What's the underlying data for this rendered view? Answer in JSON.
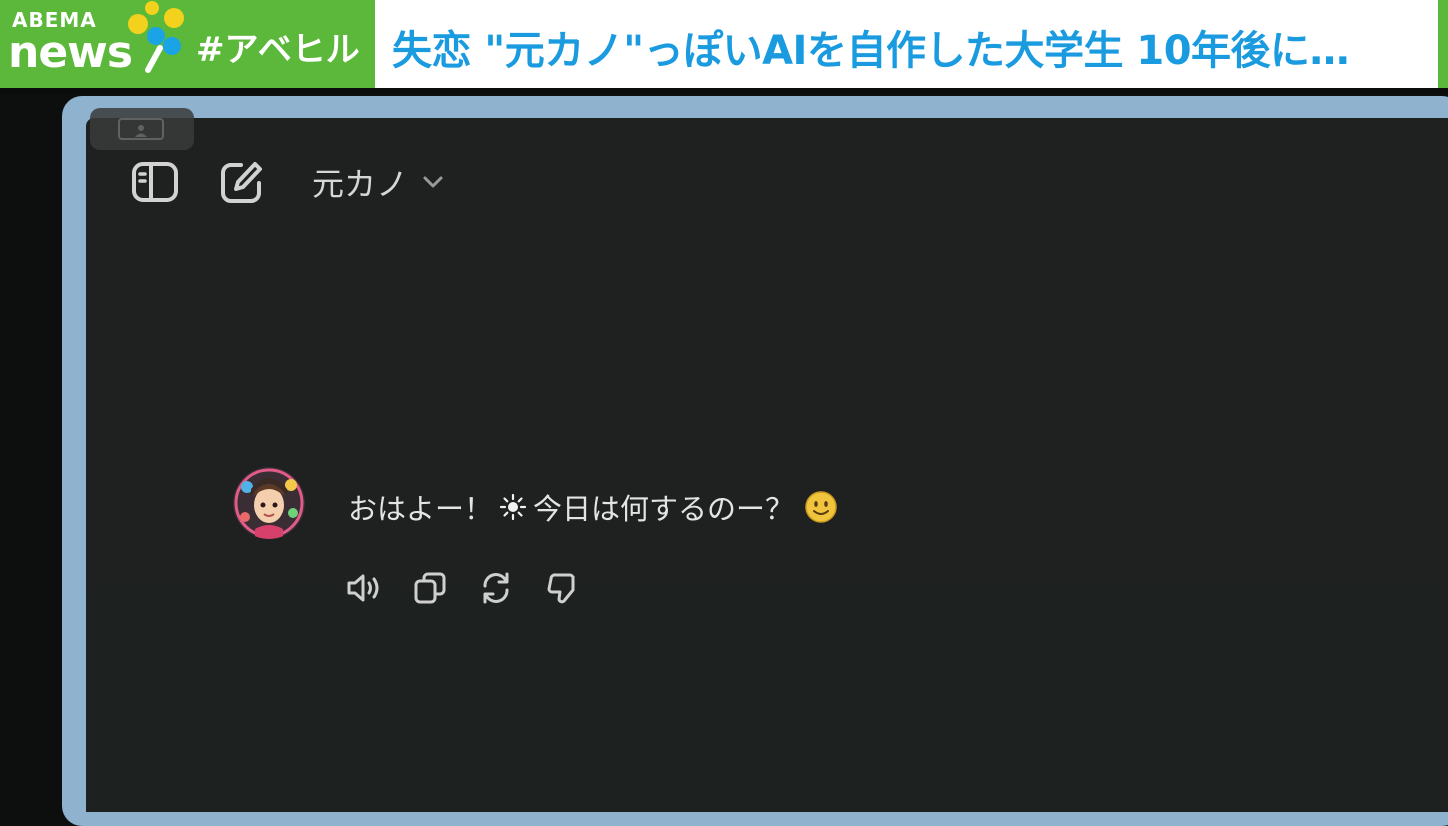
{
  "banner": {
    "logo_top": "ABEMA",
    "logo_bottom": "news",
    "hashtag": "#アベヒル",
    "headline": "失恋 \"元カノ\"っぽいAIを自作した大学生 10年後に…",
    "colors": {
      "green": "#5cb83a",
      "headline_blue": "#1a9be0",
      "yellow": "#f2d21c",
      "blue": "#1aa4e6"
    }
  },
  "app": {
    "toolbar": {
      "sidebar_icon": "sidebar-toggle-icon",
      "new_chat_icon": "new-chat-edit-icon",
      "model_label": "元カノ",
      "model_chevron": "chevron-down-icon"
    },
    "message": {
      "avatar": "anime-character-avatar",
      "text_before": "おはよー！",
      "sun_emoji": "sun-emoji",
      "text_after": "今日は何するのー？",
      "face_emoji": "smiling-face-emoji"
    },
    "actions": [
      {
        "icon": "speaker-read-aloud-icon"
      },
      {
        "icon": "copy-icon"
      },
      {
        "icon": "regenerate-icon"
      },
      {
        "icon": "thumbs-down-icon"
      }
    ]
  }
}
